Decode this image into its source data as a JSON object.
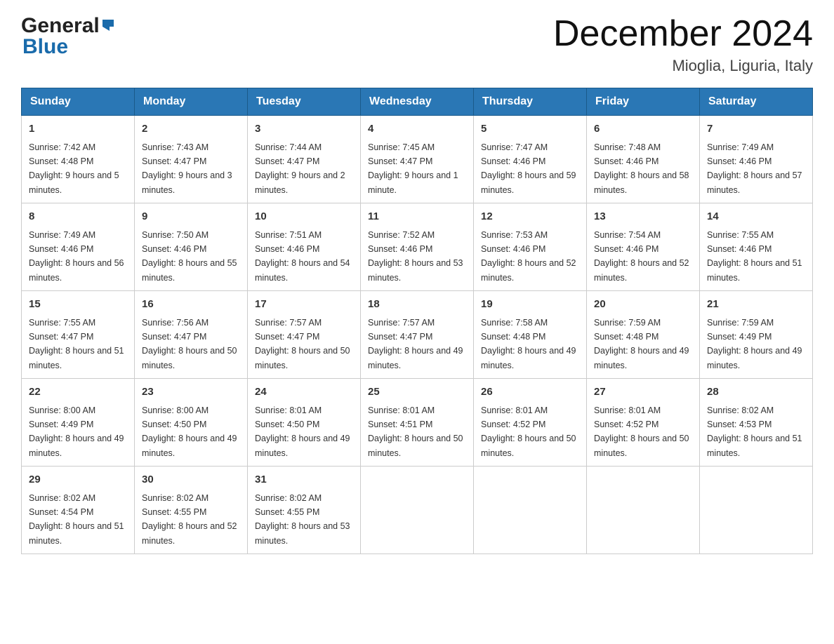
{
  "header": {
    "logo_general": "General",
    "logo_blue": "Blue",
    "title": "December 2024",
    "subtitle": "Mioglia, Liguria, Italy"
  },
  "days_of_week": [
    "Sunday",
    "Monday",
    "Tuesday",
    "Wednesday",
    "Thursday",
    "Friday",
    "Saturday"
  ],
  "weeks": [
    [
      {
        "day": "1",
        "sunrise": "7:42 AM",
        "sunset": "4:48 PM",
        "daylight": "9 hours and 5 minutes."
      },
      {
        "day": "2",
        "sunrise": "7:43 AM",
        "sunset": "4:47 PM",
        "daylight": "9 hours and 3 minutes."
      },
      {
        "day": "3",
        "sunrise": "7:44 AM",
        "sunset": "4:47 PM",
        "daylight": "9 hours and 2 minutes."
      },
      {
        "day": "4",
        "sunrise": "7:45 AM",
        "sunset": "4:47 PM",
        "daylight": "9 hours and 1 minute."
      },
      {
        "day": "5",
        "sunrise": "7:47 AM",
        "sunset": "4:46 PM",
        "daylight": "8 hours and 59 minutes."
      },
      {
        "day": "6",
        "sunrise": "7:48 AM",
        "sunset": "4:46 PM",
        "daylight": "8 hours and 58 minutes."
      },
      {
        "day": "7",
        "sunrise": "7:49 AM",
        "sunset": "4:46 PM",
        "daylight": "8 hours and 57 minutes."
      }
    ],
    [
      {
        "day": "8",
        "sunrise": "7:49 AM",
        "sunset": "4:46 PM",
        "daylight": "8 hours and 56 minutes."
      },
      {
        "day": "9",
        "sunrise": "7:50 AM",
        "sunset": "4:46 PM",
        "daylight": "8 hours and 55 minutes."
      },
      {
        "day": "10",
        "sunrise": "7:51 AM",
        "sunset": "4:46 PM",
        "daylight": "8 hours and 54 minutes."
      },
      {
        "day": "11",
        "sunrise": "7:52 AM",
        "sunset": "4:46 PM",
        "daylight": "8 hours and 53 minutes."
      },
      {
        "day": "12",
        "sunrise": "7:53 AM",
        "sunset": "4:46 PM",
        "daylight": "8 hours and 52 minutes."
      },
      {
        "day": "13",
        "sunrise": "7:54 AM",
        "sunset": "4:46 PM",
        "daylight": "8 hours and 52 minutes."
      },
      {
        "day": "14",
        "sunrise": "7:55 AM",
        "sunset": "4:46 PM",
        "daylight": "8 hours and 51 minutes."
      }
    ],
    [
      {
        "day": "15",
        "sunrise": "7:55 AM",
        "sunset": "4:47 PM",
        "daylight": "8 hours and 51 minutes."
      },
      {
        "day": "16",
        "sunrise": "7:56 AM",
        "sunset": "4:47 PM",
        "daylight": "8 hours and 50 minutes."
      },
      {
        "day": "17",
        "sunrise": "7:57 AM",
        "sunset": "4:47 PM",
        "daylight": "8 hours and 50 minutes."
      },
      {
        "day": "18",
        "sunrise": "7:57 AM",
        "sunset": "4:47 PM",
        "daylight": "8 hours and 49 minutes."
      },
      {
        "day": "19",
        "sunrise": "7:58 AM",
        "sunset": "4:48 PM",
        "daylight": "8 hours and 49 minutes."
      },
      {
        "day": "20",
        "sunrise": "7:59 AM",
        "sunset": "4:48 PM",
        "daylight": "8 hours and 49 minutes."
      },
      {
        "day": "21",
        "sunrise": "7:59 AM",
        "sunset": "4:49 PM",
        "daylight": "8 hours and 49 minutes."
      }
    ],
    [
      {
        "day": "22",
        "sunrise": "8:00 AM",
        "sunset": "4:49 PM",
        "daylight": "8 hours and 49 minutes."
      },
      {
        "day": "23",
        "sunrise": "8:00 AM",
        "sunset": "4:50 PM",
        "daylight": "8 hours and 49 minutes."
      },
      {
        "day": "24",
        "sunrise": "8:01 AM",
        "sunset": "4:50 PM",
        "daylight": "8 hours and 49 minutes."
      },
      {
        "day": "25",
        "sunrise": "8:01 AM",
        "sunset": "4:51 PM",
        "daylight": "8 hours and 50 minutes."
      },
      {
        "day": "26",
        "sunrise": "8:01 AM",
        "sunset": "4:52 PM",
        "daylight": "8 hours and 50 minutes."
      },
      {
        "day": "27",
        "sunrise": "8:01 AM",
        "sunset": "4:52 PM",
        "daylight": "8 hours and 50 minutes."
      },
      {
        "day": "28",
        "sunrise": "8:02 AM",
        "sunset": "4:53 PM",
        "daylight": "8 hours and 51 minutes."
      }
    ],
    [
      {
        "day": "29",
        "sunrise": "8:02 AM",
        "sunset": "4:54 PM",
        "daylight": "8 hours and 51 minutes."
      },
      {
        "day": "30",
        "sunrise": "8:02 AM",
        "sunset": "4:55 PM",
        "daylight": "8 hours and 52 minutes."
      },
      {
        "day": "31",
        "sunrise": "8:02 AM",
        "sunset": "4:55 PM",
        "daylight": "8 hours and 53 minutes."
      },
      null,
      null,
      null,
      null
    ]
  ],
  "labels": {
    "sunrise_prefix": "Sunrise: ",
    "sunset_prefix": "Sunset: ",
    "daylight_prefix": "Daylight: "
  }
}
